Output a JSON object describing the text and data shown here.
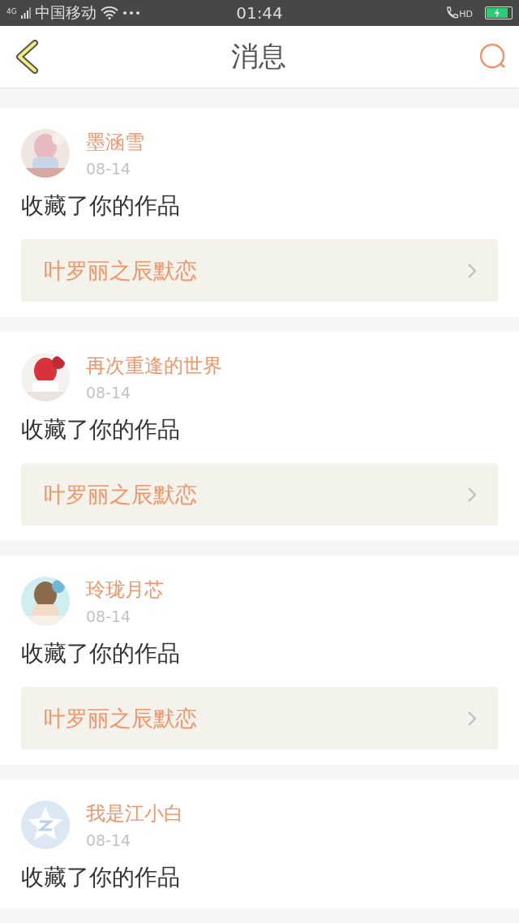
{
  "status_bar": {
    "network": "4G",
    "carrier": "中国移动",
    "time": "01:44",
    "call_badge": "HD",
    "charging": true
  },
  "header": {
    "title": "消息"
  },
  "messages": [
    {
      "user": "墨涵雪",
      "date": "08-14",
      "action": "收藏了你的作品",
      "work": "叶罗丽之辰默恋"
    },
    {
      "user": "再次重逢的世界",
      "date": "08-14",
      "action": "收藏了你的作品",
      "work": "叶罗丽之辰默恋"
    },
    {
      "user": "玲珑月芯",
      "date": "08-14",
      "action": "收藏了你的作品",
      "work": "叶罗丽之辰默恋"
    },
    {
      "user": "我是江小白",
      "avatar": {
        "kind": "default"
      },
      "date": "08-14",
      "action": "收藏了你的作品"
    }
  ]
}
